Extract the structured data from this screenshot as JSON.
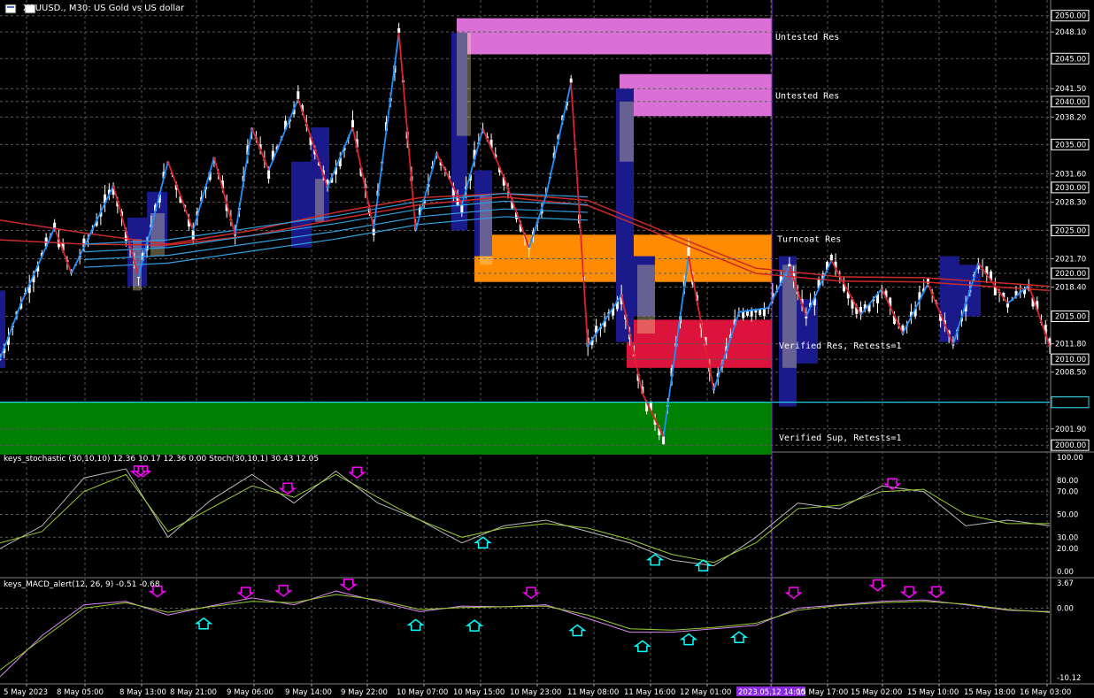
{
  "window": {
    "title": "XAUUSD., M30: US Gold vs US dollar"
  },
  "colors": {
    "background": "#000000",
    "grid": "#5a5a5a",
    "candle": "#ffffff",
    "zigzag_up": "#1e90ff",
    "zigzag_down": "#e0202c",
    "ema_red": "#cc2a2a",
    "ema_blue": "#30a0e0",
    "untested_res": "#da70d6",
    "turncoat_res": "#ff8c00",
    "verified_res": "#dc143c",
    "verified_sup": "#008000",
    "support_line": "#20d0e0",
    "bar_blue": "#1a1a8c",
    "bar_yellow": "#f5e6a0",
    "stoch_main": "#b8b8b8",
    "stoch_signal": "#9acd32",
    "macd_fast": "#dd88ee",
    "macd_slow": "#9acd32",
    "arrow_down": "#ff00ff",
    "arrow_up": "#00ffff",
    "vline": "#8a2be2",
    "price_box": "#ffffff"
  },
  "main_axis": {
    "ticks": [
      "2050.00",
      "2048.10",
      "2045.00",
      "2041.50",
      "2040.00",
      "2038.20",
      "2035.00",
      "2031.60",
      "2030.00",
      "2028.30",
      "2025.00",
      "2021.70",
      "2020.00",
      "2018.40",
      "2015.00",
      "2011.80",
      "2010.00",
      "2008.50",
      "2005.00",
      "2001.90",
      "2000.00"
    ],
    "boxed_ticks": [
      "2050.00",
      "2045.00",
      "2040.00",
      "2035.00",
      "2030.00",
      "2025.00",
      "2020.00",
      "2015.00",
      "2010.00",
      "2005.00",
      "2000.00"
    ],
    "range": [
      1999.3,
      2051.0
    ]
  },
  "zones": [
    {
      "label": "Untested Res",
      "kind": "untested_res",
      "from": 2045.5,
      "to": 2049.7
    },
    {
      "label": "Untested Res",
      "kind": "untested_res",
      "from": 2038.3,
      "to": 2043.2
    },
    {
      "label": "Turncoat Res",
      "kind": "turncoat_res",
      "from": 2019.0,
      "to": 2024.5
    },
    {
      "label": "Verified Res, Retests=1",
      "kind": "verified_res",
      "from": 2009.0,
      "to": 2014.6
    },
    {
      "label": "Verified Sup, Retests=1",
      "kind": "verified_sup",
      "from": 1998.9,
      "to": 2005.0
    }
  ],
  "price_line": {
    "value": 2005.0
  },
  "time_axis": {
    "labels": [
      "5 May 2023",
      "8 May 05:00",
      "8 May 13:00",
      "8 May 21:00",
      "9 May 06:00",
      "9 May 14:00",
      "9 May 22:00",
      "10 May 07:00",
      "10 May 15:00",
      "10 May 23:00",
      "11 May 08:00",
      "11 May 16:00",
      "12 May 01:00",
      "2023.05.12 14:00",
      "15 May 17:00",
      "15 May 02:00",
      "15 May 10:00",
      "15 May 18:00",
      "16 May 03:00"
    ],
    "highlight": "2023.05.12 14:00"
  },
  "stoch_panel": {
    "header": "keys_stochastic (30,10,10) 12.36 10.17 12.36 0.00  Stoch(30,10,1) 30.43 12.05",
    "ticks": [
      "100.00",
      "80.00",
      "70.00",
      "50.00",
      "30.00",
      "20.00",
      "0.00"
    ],
    "range": [
      0,
      100
    ]
  },
  "macd_panel": {
    "header": "keys_MACD_alert(12, 26, 9) -0.51 -0.68",
    "ticks": [
      "3.67",
      "0.00",
      "-10.12"
    ],
    "range": [
      -10.12,
      3.67
    ]
  },
  "chart_data": {
    "type": "line",
    "title": "XAUUSD., M30: US Gold vs US dollar",
    "zigzag": {
      "x_index": [
        0,
        5,
        13,
        17,
        27,
        33,
        40,
        46,
        51,
        56,
        60,
        64,
        71,
        78,
        84,
        89,
        95,
        99,
        104,
        110,
        115,
        120,
        126,
        130,
        136,
        140,
        148,
        153,
        158,
        164,
        170,
        176,
        183,
        188,
        192,
        198,
        205,
        210,
        215,
        221,
        227,
        233,
        240,
        245,
        250
      ],
      "price": [
        2010.0,
        2016.5,
        2025.3,
        2020.0,
        2030.2,
        2019.6,
        2033.0,
        2025.0,
        2033.5,
        2024.5,
        2036.9,
        2032.0,
        2040.3,
        2030.0,
        2037.0,
        2025.2,
        2048.0,
        2025.0,
        2034.0,
        2028.0,
        2036.8,
        2031.2,
        2023.0,
        2029.0,
        2042.2,
        2011.5,
        2017.5,
        2006.0,
        2001.0,
        2022.0,
        2006.4,
        2015.5,
        2016.0,
        2020.8,
        2015.0,
        2021.5,
        2015.2,
        2018.2,
        2013.0,
        2018.8,
        2011.7,
        2021.2,
        2016.5,
        2018.6,
        2011.5
      ]
    },
    "ema_red_1": {
      "x_index": [
        0,
        20,
        40,
        60,
        80,
        100,
        120,
        140,
        160,
        180,
        200,
        220,
        250
      ],
      "price": [
        2026.2,
        2024.7,
        2023.4,
        2025.0,
        2027.1,
        2028.8,
        2029.3,
        2028.5,
        2024.5,
        2020.6,
        2019.6,
        2019.5,
        2018.5
      ]
    },
    "ema_red_2": {
      "x_index": [
        0,
        20,
        40,
        60,
        80,
        100,
        120,
        140,
        160,
        180,
        200,
        220,
        250
      ],
      "price": [
        2023.9,
        2023.4,
        2023.3,
        2024.4,
        2026.3,
        2028.0,
        2028.9,
        2027.9,
        2024.0,
        2020.0,
        2019.1,
        2019.0,
        2018.0
      ]
    },
    "ema_blue": {
      "x_index": [
        20,
        40,
        60,
        80,
        100,
        120,
        140
      ],
      "price": [
        2022.5,
        2023.0,
        2024.4,
        2025.8,
        2027.5,
        2028.4,
        2028.0
      ]
    },
    "stochastic": {
      "x_index": [
        0,
        10,
        20,
        30,
        40,
        50,
        60,
        70,
        80,
        90,
        100,
        110,
        120,
        130,
        140,
        150,
        160,
        170,
        180,
        190,
        200,
        210,
        220,
        230,
        240,
        250
      ],
      "main": [
        20,
        40,
        82,
        90,
        30,
        62,
        85,
        60,
        88,
        60,
        45,
        25,
        40,
        45,
        35,
        25,
        10,
        5,
        30,
        60,
        55,
        75,
        70,
        40,
        45,
        40
      ],
      "signal": [
        25,
        35,
        70,
        85,
        35,
        55,
        75,
        65,
        85,
        65,
        45,
        30,
        38,
        42,
        38,
        28,
        15,
        8,
        25,
        55,
        58,
        70,
        72,
        50,
        42,
        42
      ]
    },
    "macd": {
      "x_index": [
        0,
        10,
        20,
        30,
        40,
        50,
        60,
        70,
        80,
        90,
        100,
        110,
        120,
        130,
        140,
        150,
        160,
        170,
        180,
        190,
        200,
        210,
        220,
        230,
        240,
        250
      ],
      "fast": [
        -10,
        -4,
        0.5,
        1,
        -1,
        0.3,
        1.5,
        0.5,
        2.5,
        1.0,
        -0.5,
        0.3,
        0.2,
        0.5,
        -1.5,
        -3.5,
        -3.5,
        -3.0,
        -2.5,
        0,
        0.5,
        1.0,
        1.2,
        0.5,
        -0.3,
        -0.5
      ],
      "slow": [
        -9,
        -4.5,
        0,
        0.8,
        -0.6,
        0.2,
        1.0,
        0.8,
        2.0,
        1.2,
        -0.2,
        0.1,
        0.2,
        0.3,
        -1.0,
        -3.0,
        -3.2,
        -2.8,
        -2.2,
        -0.3,
        0.4,
        0.8,
        1.0,
        0.6,
        -0.2,
        -0.6
      ]
    },
    "stoch_signals": [
      {
        "dir": "down",
        "x_index": 66,
        "value": 83
      },
      {
        "dir": "down",
        "x_index": 68,
        "value": 83
      },
      {
        "dir": "down",
        "x_index": 137,
        "value": 68
      },
      {
        "dir": "down",
        "x_index": 170,
        "value": 82
      },
      {
        "dir": "up",
        "x_index": 230,
        "value": 30
      },
      {
        "dir": "up",
        "x_index": 312,
        "value": 15
      },
      {
        "dir": "up",
        "x_index": 335,
        "value": 10
      },
      {
        "dir": "down",
        "x_index": 425,
        "value": 72
      }
    ],
    "macd_signals": [
      {
        "dir": "down",
        "x_index": 75,
        "value": 1.4
      },
      {
        "dir": "up",
        "x_index": 97,
        "value": -1.2
      },
      {
        "dir": "down",
        "x_index": 117,
        "value": 1.2
      },
      {
        "dir": "down",
        "x_index": 135,
        "value": 1.5
      },
      {
        "dir": "down",
        "x_index": 166,
        "value": 2.4
      },
      {
        "dir": "up",
        "x_index": 198,
        "value": -1.4
      },
      {
        "dir": "up",
        "x_index": 226,
        "value": -1.5
      },
      {
        "dir": "down",
        "x_index": 253,
        "value": 1.2
      },
      {
        "dir": "up",
        "x_index": 275,
        "value": -2.2
      },
      {
        "dir": "up",
        "x_index": 306,
        "value": -4.5
      },
      {
        "dir": "up",
        "x_index": 328,
        "value": -3.5
      },
      {
        "dir": "up",
        "x_index": 352,
        "value": -3.2
      },
      {
        "dir": "down",
        "x_index": 378,
        "value": 1.2
      },
      {
        "dir": "down",
        "x_index": 418,
        "value": 2.3
      },
      {
        "dir": "down",
        "x_index": 433,
        "value": 1.3
      },
      {
        "dir": "down",
        "x_index": 446,
        "value": 1.3
      }
    ],
    "xlabel": "",
    "ylabel": "",
    "grid": true
  }
}
